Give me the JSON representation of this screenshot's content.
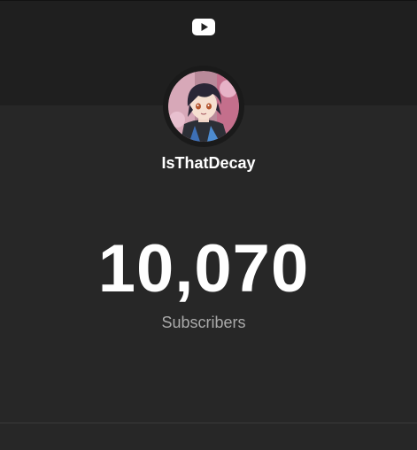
{
  "header": {
    "logo_icon": "youtube-logo-icon",
    "background": "#1f1f1f"
  },
  "channel": {
    "name": "IsThatDecay",
    "avatar": "anime-character-avatar"
  },
  "stats": {
    "subscriber_count": "10,070",
    "subscriber_label": "Subscribers"
  },
  "colors": {
    "background": "#272727",
    "text_primary": "#ffffff",
    "text_secondary": "#aaaaaa"
  }
}
